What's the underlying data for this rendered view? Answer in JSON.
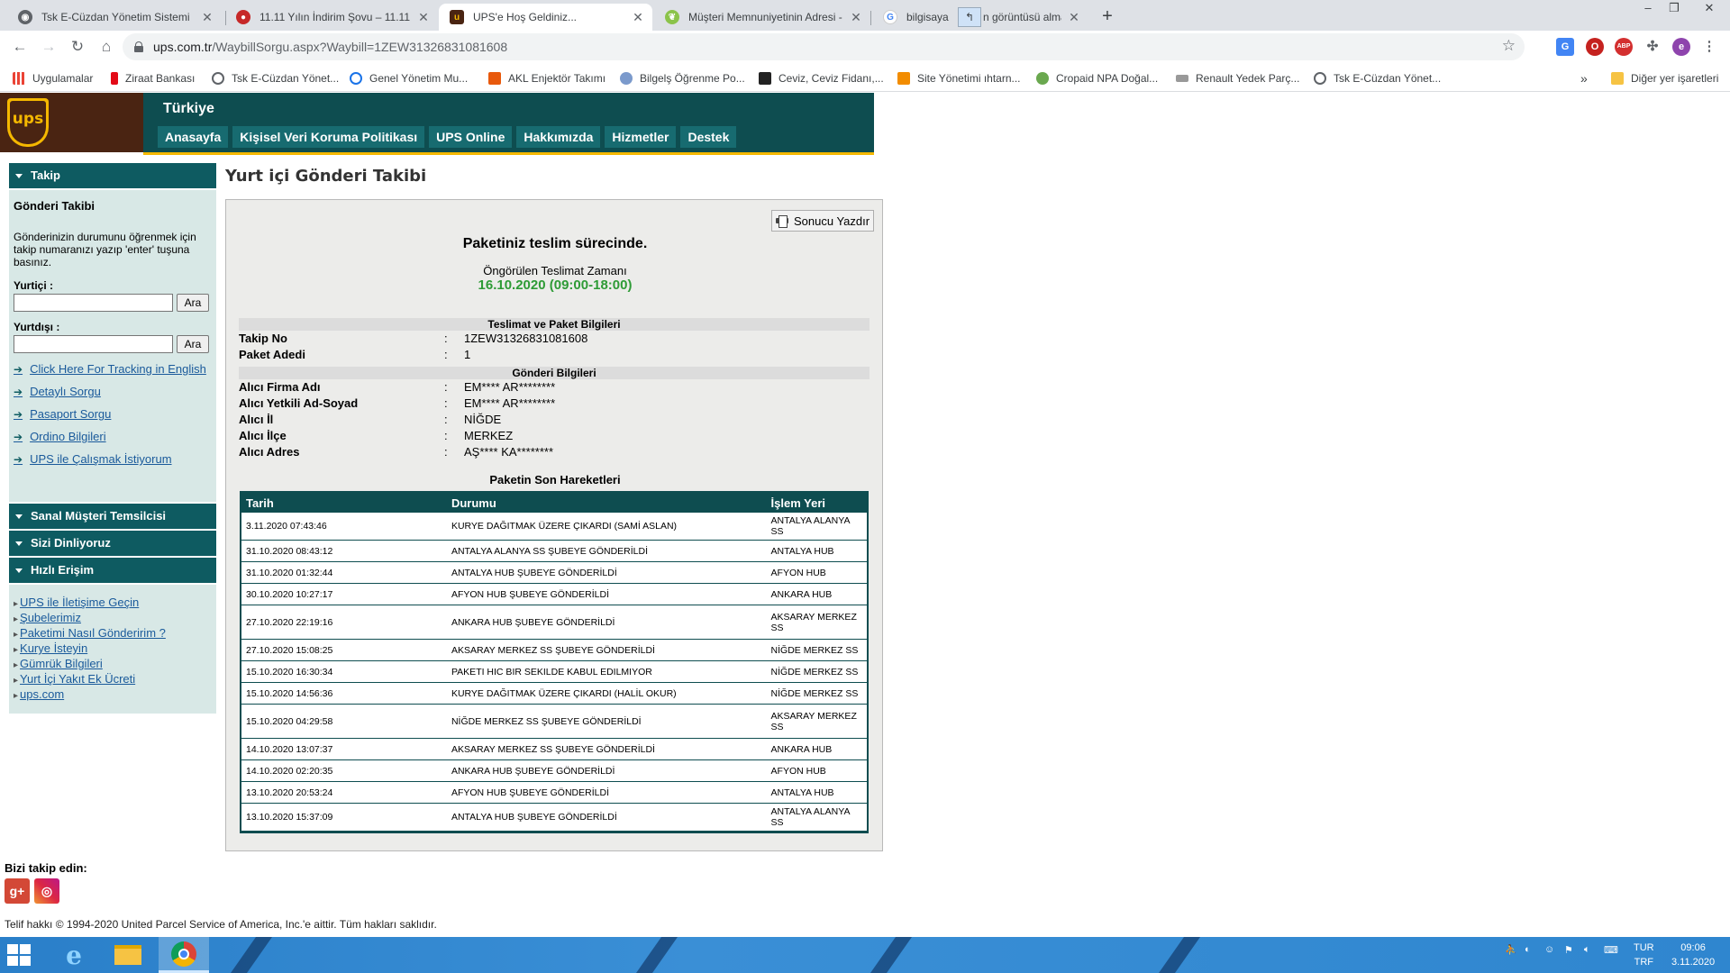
{
  "browser": {
    "tabs": [
      {
        "title": "Tsk E-Cüzdan Yönetim Sistemi",
        "icon": "globe-icon",
        "active": false
      },
      {
        "title": "11.11 Yılın İndirim Şovu – 11.11 İ",
        "icon": "shop-icon",
        "active": false
      },
      {
        "title": "UPS'e Hoş Geldiniz...",
        "icon": "ups-icon",
        "active": true
      },
      {
        "title": "Müşteri Memnuniyetinin Adresi -",
        "icon": "leaf-icon",
        "active": false
      },
      {
        "title": "bilgisaya",
        "icon": "google-icon",
        "active": false
      },
      {
        "title": "n görüntüsü alma",
        "icon": "drag-icon",
        "active": false
      }
    ],
    "new_tab": "+",
    "window_controls": {
      "minimize": "–",
      "restore": "❐",
      "close": "✕"
    },
    "url_host": "ups.com.tr",
    "url_path": "/WaybillSorgu.aspx?Waybill=1ZEW31326831081608",
    "profile_letter": "e",
    "ext_badge": "ABP",
    "bookmarks": [
      {
        "label": "Uygulamalar",
        "color": "#ea4335"
      },
      {
        "label": "Ziraat Bankası",
        "color": "#e30a17"
      },
      {
        "label": "Tsk E-Cüzdan Yönet...",
        "color": "#5f6368"
      },
      {
        "label": "Genel Yönetim Mu...",
        "color": "#1a73e8"
      },
      {
        "label": "AKL Enjektör Takımı",
        "color": "#e8590c"
      },
      {
        "label": "Bilgelş Öğrenme Po...",
        "color": "#7b9acc"
      },
      {
        "label": "Ceviz, Ceviz Fidanı,...",
        "color": "#222222"
      },
      {
        "label": "Site Yönetimi ıhtarn...",
        "color": "#f28c00"
      },
      {
        "label": "Cropaid NPA Doğal...",
        "color": "#6aa84f"
      },
      {
        "label": "Renault Yedek Parç...",
        "color": "#999999"
      },
      {
        "label": "Tsk E-Cüzdan Yönet...",
        "color": "#5f6368"
      }
    ],
    "more_bookmarks": "»",
    "other_bookmarks": "Diğer yer işaretleri"
  },
  "header": {
    "logo_text": "ups",
    "country": "Türkiye",
    "nav": [
      "Anasayfa",
      "Kişisel Veri Koruma Politikası",
      "UPS Online",
      "Hakkımızda",
      "Hizmetler",
      "Destek"
    ]
  },
  "sidebar": {
    "takip_title": "Takip",
    "panel_title": "Gönderi Takibi",
    "instructions": "Gönderinizin durumunu öğrenmek için takip numaranızı yazıp 'enter' tuşuna basınız.",
    "domestic_label": "Yurtiçi :",
    "international_label": "Yurtdışı :",
    "search_button": "Ara",
    "links": [
      "Click Here For Tracking in English",
      "Detaylı Sorgu",
      "Pasaport Sorgu",
      "Ordino Bilgileri",
      "UPS ile Çalışmak İstiyorum"
    ],
    "sections": [
      "Sanal Müşteri Temsilcisi",
      "Sizi Dinliyoruz",
      "Hızlı Erişim"
    ],
    "quick_links": [
      "UPS ile İletişime Geçin",
      "Şubelerimiz",
      "Paketimi Nasıl Gönderirim ?",
      "Kurye İsteyin",
      "Gümrük Bilgileri",
      "Yurt İçi Yakıt Ek Ücreti",
      "ups.com"
    ]
  },
  "main": {
    "title": "Yurt içi Gönderi Takibi",
    "print_button": "Sonucu Yazdır",
    "status": "Paketiniz teslim sürecinde.",
    "eta_label": "Öngörülen Teslimat Zamanı",
    "eta_value": "16.10.2020 (09:00-18:00)",
    "section_delivery": "Teslimat ve Paket Bilgileri",
    "section_shipment": "Gönderi Bilgileri",
    "colon": ":",
    "tracking_no_label": "Takip No",
    "tracking_no": "1ZEW31326831081608",
    "package_count_label": "Paket Adedi",
    "package_count": "1",
    "recipient_company_label": "Alıcı Firma Adı",
    "recipient_company": "EM**** AR********",
    "recipient_contact_label": "Alıcı Yetkili Ad-Soyad",
    "recipient_contact": "EM**** AR********",
    "recipient_city_label": "Alıcı İl",
    "recipient_city": "NİĞDE",
    "recipient_district_label": "Alıcı İlçe",
    "recipient_district": "MERKEZ",
    "recipient_address_label": "Alıcı Adres",
    "recipient_address": "AŞ**** KA********",
    "moves_title": "Paketin Son Hareketleri",
    "moves_headers": [
      "Tarih",
      "Durumu",
      "İşlem Yeri"
    ],
    "moves": [
      [
        "3.11.2020 07:43:46",
        "KURYE DAĞITMAK ÜZERE ÇIKARDI (SAMİ ASLAN)",
        "ANTALYA ALANYA SS"
      ],
      [
        "31.10.2020 08:43:12",
        "ANTALYA ALANYA SS ŞUBEYE GÖNDERİLDİ",
        "ANTALYA HUB"
      ],
      [
        "31.10.2020 01:32:44",
        "ANTALYA HUB ŞUBEYE GÖNDERİLDİ",
        "AFYON HUB"
      ],
      [
        "30.10.2020 10:27:17",
        "AFYON HUB ŞUBEYE GÖNDERİLDİ",
        "ANKARA HUB"
      ],
      [
        "27.10.2020 22:19:16",
        "ANKARA HUB ŞUBEYE GÖNDERİLDİ",
        "AKSARAY MERKEZ SS"
      ],
      [
        "27.10.2020 15:08:25",
        "AKSARAY MERKEZ SS ŞUBEYE GÖNDERİLDİ",
        "NİĞDE MERKEZ SS"
      ],
      [
        "15.10.2020 16:30:34",
        "PAKETI HIC BIR SEKILDE KABUL EDILMIYOR",
        "NİĞDE MERKEZ SS"
      ],
      [
        "15.10.2020 14:56:36",
        "KURYE DAĞITMAK ÜZERE ÇIKARDI (HALİL OKUR)",
        "NİĞDE MERKEZ SS"
      ],
      [
        "15.10.2020 04:29:58",
        "NİĞDE MERKEZ SS ŞUBEYE GÖNDERİLDİ",
        "AKSARAY MERKEZ SS"
      ],
      [
        "14.10.2020 13:07:37",
        "AKSARAY MERKEZ SS ŞUBEYE GÖNDERİLDİ",
        "ANKARA HUB"
      ],
      [
        "14.10.2020 02:20:35",
        "ANKARA HUB ŞUBEYE GÖNDERİLDİ",
        "AFYON HUB"
      ],
      [
        "13.10.2020 20:53:24",
        "AFYON HUB ŞUBEYE GÖNDERİLDİ",
        "ANTALYA HUB"
      ],
      [
        "13.10.2020 15:37:09",
        "ANTALYA HUB ŞUBEYE GÖNDERİLDİ",
        "ANTALYA ALANYA SS"
      ]
    ]
  },
  "footer": {
    "follow": "Bizi takip edin:",
    "gplus": "g+",
    "copyright": "Telif hakkı © 1994-2020 United Parcel Service of America, Inc.'e aittir. Tüm hakları saklıdır."
  },
  "taskbar": {
    "lang_top": "TUR",
    "lang_bottom": "TRF",
    "time": "09:06",
    "date": "3.11.2020"
  },
  "colors": {
    "ups_brown": "#4a2412",
    "ups_gold": "#f5b800",
    "ups_teal": "#0e4d50",
    "eta_green": "#2e9b36",
    "link_blue": "#1a5a9b"
  }
}
